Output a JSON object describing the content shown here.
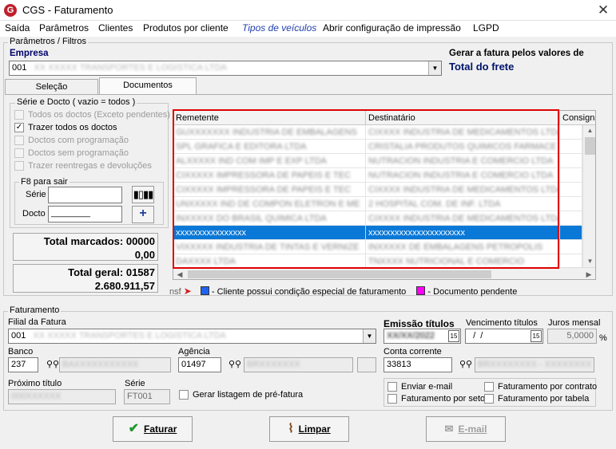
{
  "window": {
    "title": "CGS - Faturamento",
    "logo_glyph": "G"
  },
  "menu": [
    "Saída",
    "Parâmetros",
    "Clientes",
    "Produtos por cliente",
    "Tipos de veículos",
    "Abrir configuração de impressão",
    "LGPD"
  ],
  "params": {
    "legend": "Parâmetros / Filtros",
    "empresa_label": "Empresa",
    "empresa_code": "001",
    "empresa_name": "XX XXXXX TRANSPORTES E LOGISTICA LTDA",
    "gerar_label": "Gerar a fatura pelos valores de",
    "gerar_value": "Total do frete"
  },
  "tabs": [
    "Seleção",
    "Documentos"
  ],
  "serie": {
    "legend": "Série e Docto  ( vazio = todos )",
    "options": [
      {
        "label": "Todos os doctos (Exceto pendentes)",
        "checked": false,
        "enabled": false
      },
      {
        "label": "Trazer todos os doctos",
        "checked": true,
        "enabled": true
      },
      {
        "label": "Doctos com programação",
        "checked": false,
        "enabled": false
      },
      {
        "label": "Doctos sem programação",
        "checked": false,
        "enabled": false
      },
      {
        "label": "Trazer reentregas e devoluções",
        "checked": false,
        "enabled": false
      }
    ]
  },
  "f8": {
    "legend": "F8 para sair",
    "serie_label": "Série",
    "docto_label": "Docto",
    "docto_mask": "________"
  },
  "totals": {
    "marcados_label": "Total marcados:",
    "marcados_count": "00000",
    "marcados_value": "0,00",
    "geral_label": "Total geral:",
    "geral_count": "01587",
    "geral_value": "2.680.911,57"
  },
  "grid": {
    "headers": [
      "Remetente",
      "Destinatário",
      "Consignatário"
    ],
    "rows": [
      [
        "GUXXXXXXX INDUSTRIA DE EMBALAGENS",
        "CIXXXX INDUSTRIA DE MEDICAMENTOS LTDA",
        "",
        false
      ],
      [
        "SPL GRAFICA E EDITORA LTDA",
        "CRISTALIA PRODUTOS QUIMICOS FARMACE",
        "",
        false
      ],
      [
        "ALXXXXX IND COM IMP E EXP LTDA",
        "NUTRACION INDUSTRIA E COMERCIO LTDA",
        "",
        false
      ],
      [
        "CIXXXXX IMPRESSORA DE PAPEIS E TEC",
        "NUTRACION INDUSTRIA E COMERCIO LTDA",
        "",
        false
      ],
      [
        "CIXXXXX IMPRESSORA DE PAPEIS E TEC",
        "CIXXXX INDUSTRIA DE MEDICAMENTOS LTDA",
        "",
        false
      ],
      [
        "UNXXXXX IND DE COMPON ELETRON E ME",
        "2 HOSPITAL COM. DE INF. LTDA",
        "",
        false
      ],
      [
        "INXXXXX DO BRASIL QUIMICA LTDA",
        "CIXXXX INDUSTRIA DE MEDICAMENTOS LTDA",
        "",
        false
      ],
      [
        "xxxxxxxxxxxxxxxx",
        "xxxxxxxxxxxxxxxxxxxxxx",
        "",
        true
      ],
      [
        "VIXXXXX INDUSTRIA DE TINTAS E VERNIZE",
        "INXXXXX DE EMBALAGENS PETROPOLIS",
        "",
        false
      ],
      [
        "DAXXXX LTDA",
        "TNXXXX NUTRICIONAL E COMERCIO",
        "",
        false
      ]
    ]
  },
  "legend_row": {
    "prefix": "nsf",
    "items": [
      {
        "color": "#1e63f0",
        "text": " - Cliente possui condição especial de faturamento"
      },
      {
        "color": "#ff00ff",
        "text": " - Documento pendente"
      }
    ]
  },
  "faturamento": {
    "legend": "Faturamento",
    "filial_label": "Filial da Fatura",
    "filial_code": "001",
    "filial_name": "XX XXXXX TRANSPORTES E LOGISTICA LTDA",
    "emissao_label": "Emissão títulos",
    "emissao_value": "XX/XX/2022",
    "vencimento_label": "Vencimento títulos",
    "vencimento_value": "  /  /",
    "juros_label": "Juros mensal",
    "juros_value": "5,0000",
    "juros_unit": "%",
    "banco_label": "Banco",
    "banco_code": "237",
    "banco_name": "BAXXXXXXXXXXX",
    "agencia_label": "Agência",
    "agencia_code": "01497",
    "agencia_name": "BRXXXXXXX",
    "conta_label": "Conta corrente",
    "conta_code": "33813",
    "conta_name": "BRXXXXXXXX - XXXXXXXX",
    "proximo_label": "Próximo título",
    "proximo_value": "000XXXXXX",
    "serie_label": "Série",
    "serie_value": "FT001",
    "gerar_listagem": "Gerar listagem de pré-fatura",
    "checks": [
      "Enviar e-mail",
      "Faturamento por contrato",
      "Faturamento por setor",
      "Faturamento por tabela"
    ]
  },
  "buttons": {
    "faturar": "Faturar",
    "limpar": "Limpar",
    "email": "E-mail"
  }
}
